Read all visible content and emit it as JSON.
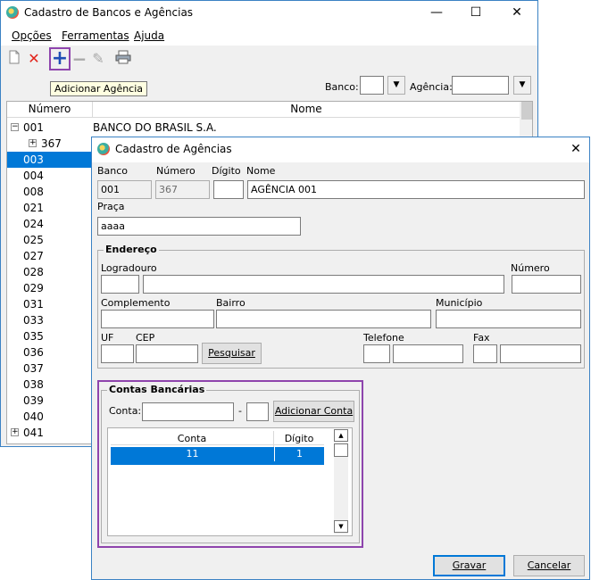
{
  "main_window": {
    "title": "Cadastro de Bancos e Agências",
    "controls": {
      "minimize": "—",
      "maximize": "☐",
      "close": "✕"
    }
  },
  "menu": [
    {
      "label": "Opções",
      "access_key": "O"
    },
    {
      "label": "Ferramentas",
      "access_key": "F"
    },
    {
      "label": "Ajuda",
      "access_key": "A"
    }
  ],
  "toolbar": {
    "tooltip": "Adicionar Agência",
    "icons": [
      "new-document-icon",
      "delete-icon",
      "add-icon",
      "remove-icon",
      "edit-icon",
      "print-icon"
    ]
  },
  "filters": {
    "banco_label": "Banco:",
    "banco_value": "",
    "agencia_label": "Agência:",
    "agencia_value": ""
  },
  "tree_grid": {
    "columns": [
      "Número",
      "Nome"
    ],
    "rows": [
      {
        "numero": "001",
        "nome": "BANCO DO BRASIL S.A.",
        "expander": "−",
        "level": 0
      },
      {
        "numero": "367",
        "nome": "",
        "expander": "+",
        "level": 1
      },
      {
        "numero": "003",
        "nome": "",
        "expander": "",
        "level": 0,
        "selected": true
      },
      {
        "numero": "004",
        "nome": "",
        "expander": "",
        "level": 0
      },
      {
        "numero": "008",
        "nome": "",
        "expander": "",
        "level": 0
      },
      {
        "numero": "021",
        "nome": "",
        "expander": "",
        "level": 0
      },
      {
        "numero": "024",
        "nome": "",
        "expander": "",
        "level": 0
      },
      {
        "numero": "025",
        "nome": "",
        "expander": "",
        "level": 0
      },
      {
        "numero": "027",
        "nome": "",
        "expander": "",
        "level": 0
      },
      {
        "numero": "028",
        "nome": "",
        "expander": "",
        "level": 0
      },
      {
        "numero": "029",
        "nome": "",
        "expander": "",
        "level": 0
      },
      {
        "numero": "031",
        "nome": "",
        "expander": "",
        "level": 0
      },
      {
        "numero": "033",
        "nome": "",
        "expander": "",
        "level": 0
      },
      {
        "numero": "035",
        "nome": "",
        "expander": "",
        "level": 0
      },
      {
        "numero": "036",
        "nome": "",
        "expander": "",
        "level": 0
      },
      {
        "numero": "037",
        "nome": "",
        "expander": "",
        "level": 0
      },
      {
        "numero": "038",
        "nome": "",
        "expander": "",
        "level": 0
      },
      {
        "numero": "039",
        "nome": "",
        "expander": "",
        "level": 0
      },
      {
        "numero": "040",
        "nome": "",
        "expander": "",
        "level": 0
      },
      {
        "numero": "041",
        "nome": "",
        "expander": "+",
        "level": 0
      }
    ]
  },
  "dialog": {
    "title": "Cadastro de Agências",
    "close": "✕",
    "banco_label": "Banco",
    "banco_value": "001",
    "numero_label": "Número",
    "numero_value": "367",
    "digito_label": "Dígito",
    "digito_value": "",
    "nome_label": "Nome",
    "nome_value": "AGÊNCIA 001",
    "praca_label": "Praça",
    "praca_value": "aaaa",
    "endereco": {
      "title": "Endereço",
      "logradouro_label": "Logradouro",
      "numero_label": "Número",
      "complemento_label": "Complemento",
      "bairro_label": "Bairro",
      "municipio_label": "Município",
      "uf_label": "UF",
      "cep_label": "CEP",
      "pesquisar_label": "Pesquisar",
      "telefone_label": "Telefone",
      "fax_label": "Fax"
    },
    "contas": {
      "title": "Contas Bancárias",
      "conta_label": "Conta:",
      "separator": "-",
      "adicionar_label": "Adicionar Conta",
      "columns": [
        "Conta",
        "Dígito"
      ],
      "rows": [
        {
          "conta": "11",
          "digito": "1"
        }
      ]
    },
    "gravar_label": "Gravar",
    "cancelar_label": "Cancelar"
  },
  "colors": {
    "selection": "#0078d7",
    "highlight_box": "#8e44ad",
    "tooltip_bg": "#ffffe1",
    "add_icon": "#1f4fb5",
    "delete_icon": "#e2231a"
  }
}
